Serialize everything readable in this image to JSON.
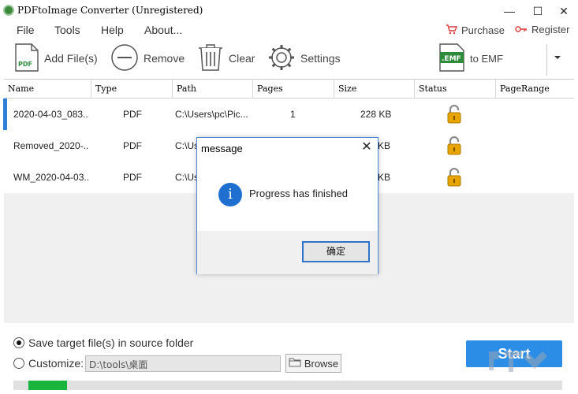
{
  "window": {
    "title": "PDFtoImage Converter (Unregistered)",
    "minimize": "—",
    "maximize": "☐",
    "close": "✕"
  },
  "menu": {
    "items": [
      "File",
      "Tools",
      "Help",
      "About..."
    ],
    "purchase": "Purchase",
    "register": "Register"
  },
  "toolbar": {
    "add_files": "Add File(s)",
    "remove": "Remove",
    "clear": "Clear",
    "settings": "Settings",
    "format_badge": ".EMF",
    "to_format": "to EMF",
    "pdf_badge": "PDF"
  },
  "grid": {
    "headers": [
      "Name",
      "Type",
      "Path",
      "Pages",
      "Size",
      "Status",
      "PageRange"
    ],
    "rows": [
      {
        "name": "2020-04-03_083...",
        "type": "PDF",
        "path": "C:\\Users\\pc\\Pic...",
        "pages": "1",
        "size": "228 KB",
        "status_icon": "unlocked-padlock-icon",
        "page_range": ""
      },
      {
        "name": "Removed_2020-...",
        "type": "PDF",
        "path": "C:\\Us",
        "pages": "",
        "size": "KB",
        "status_icon": "unlocked-padlock-icon",
        "page_range": ""
      },
      {
        "name": "WM_2020-04-03...",
        "type": "PDF",
        "path": "C:\\Us",
        "pages": "",
        "size": "KB",
        "status_icon": "unlocked-padlock-icon",
        "page_range": ""
      }
    ]
  },
  "output": {
    "save_source_label": "Save target file(s) in source folder",
    "customize_label": "Customize:",
    "path_value": "D:\\tools\\桌面",
    "browse_label": "Browse",
    "start_label": "Start",
    "progress_fraction": 0.07
  },
  "dialog": {
    "title": "message",
    "close": "✕",
    "info_glyph": "i",
    "message": "Progress has finished",
    "ok_label": "确定"
  },
  "colors": {
    "accent": "#2b8de6",
    "progress": "#18b43c",
    "row_marker": "#2f7fd8",
    "lock": "#e8a400"
  }
}
